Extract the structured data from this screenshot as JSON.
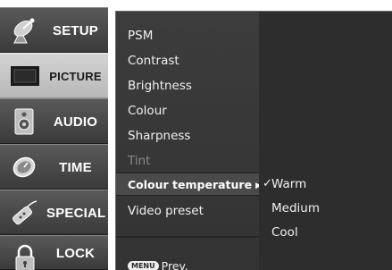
{
  "sidebar": {
    "items": [
      {
        "label": "SETUP",
        "icon": "satellite-dish-icon"
      },
      {
        "label": "PICTURE",
        "icon": "tv-screen-icon"
      },
      {
        "label": "AUDIO",
        "icon": "speaker-icon"
      },
      {
        "label": "TIME",
        "icon": "clock-icon"
      },
      {
        "label": "SPECIAL",
        "icon": "remote-control-icon"
      },
      {
        "label": "LOCK",
        "icon": "padlock-icon"
      }
    ],
    "active": "PICTURE"
  },
  "menu": {
    "items": [
      {
        "label": "PSM"
      },
      {
        "label": "Contrast"
      },
      {
        "label": "Brightness"
      },
      {
        "label": "Colour"
      },
      {
        "label": "Sharpness"
      },
      {
        "label": "Tint",
        "disabled": true
      },
      {
        "label": "Colour temperature",
        "selected": true,
        "has_submenu": true,
        "arrow": "▶"
      },
      {
        "label": "Video preset"
      }
    ],
    "footer": {
      "key_label": "MENU",
      "text": "Prev."
    }
  },
  "submenu": {
    "options": [
      {
        "label": "Warm",
        "checked": true,
        "check_mark": "✓"
      },
      {
        "label": "Medium",
        "checked": false
      },
      {
        "label": "Cool",
        "checked": false
      }
    ]
  },
  "colors": {
    "panel_background": "#3c3c3c",
    "submenu_background": "#2d2d2d",
    "active_category": "#c8c8c8",
    "text": "#f0f0f0",
    "disabled_text": "#8a8a8a"
  }
}
